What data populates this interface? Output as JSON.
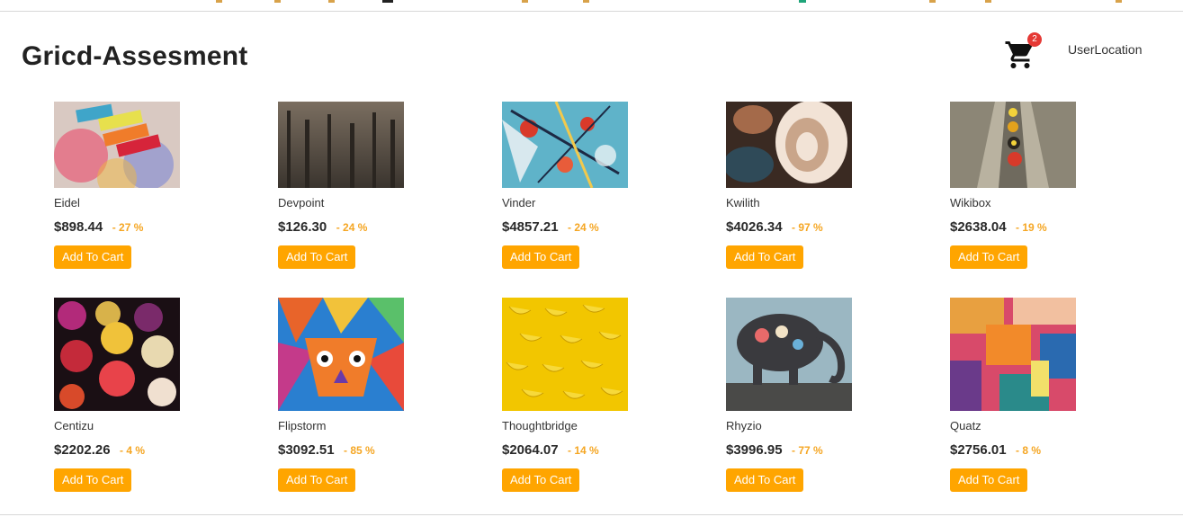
{
  "header": {
    "title": "Gricd-Assesment",
    "cart_count": "2",
    "user_location_label": "UserLocation"
  },
  "colors": {
    "accent": "#ffa500",
    "discount": "#f5a623",
    "badge": "#e53935"
  },
  "products": [
    {
      "name": "Eidel",
      "price": "$898.44",
      "discount": "- 27 %",
      "button": "Add To Cart",
      "image": "pastel-chalks-photo"
    },
    {
      "name": "Devpoint",
      "price": "$126.30",
      "discount": "- 24 %",
      "button": "Add To Cart",
      "image": "misty-forest-photo"
    },
    {
      "name": "Vinder",
      "price": "$4857.21",
      "discount": "- 24 %",
      "button": "Add To Cart",
      "image": "abstract-paint-splatter-photo"
    },
    {
      "name": "Kwilith",
      "price": "$4026.34",
      "discount": "- 97 %",
      "button": "Add To Cart",
      "image": "fluid-art-photo"
    },
    {
      "name": "Wikibox",
      "price": "$2638.04",
      "discount": "- 19 %",
      "button": "Add To Cart",
      "image": "street-graffiti-photo"
    },
    {
      "name": "Centizu",
      "price": "$2202.26",
      "discount": "- 4 %",
      "button": "Add To Cart",
      "image": "colorful-lanterns-photo"
    },
    {
      "name": "Flipstorm",
      "price": "$3092.51",
      "discount": "- 85 %",
      "button": "Add To Cart",
      "image": "geometric-lion-mural-photo"
    },
    {
      "name": "Thoughtbridge",
      "price": "$2064.07",
      "discount": "- 14 %",
      "button": "Add To Cart",
      "image": "bananas-pattern-photo"
    },
    {
      "name": "Rhyzio",
      "price": "$3996.95",
      "discount": "- 77 %",
      "button": "Add To Cart",
      "image": "elephant-mural-photo"
    },
    {
      "name": "Quatz",
      "price": "$2756.01",
      "discount": "- 8 %",
      "button": "Add To Cart",
      "image": "abstract-painting-photo"
    }
  ]
}
